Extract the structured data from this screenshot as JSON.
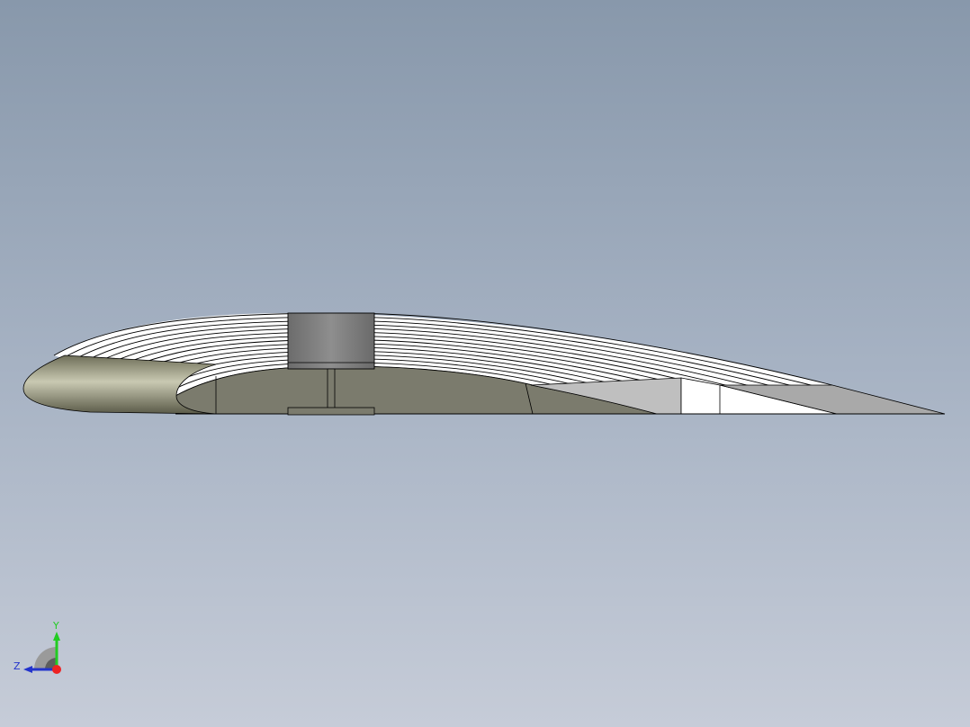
{
  "viewport": {
    "background_top": "#8898ab",
    "background_bottom": "#c6ccd8"
  },
  "model": {
    "part_fill_dark": "#7b7b6d",
    "part_fill_light": "#c0c0c0",
    "spar_fill": "#777777",
    "edge_color": "#000000"
  },
  "triad": {
    "y_label": "Y",
    "z_label": "Z",
    "y_color": "#22cc22",
    "z_color": "#2233cc",
    "x_color": "#ee2222"
  }
}
